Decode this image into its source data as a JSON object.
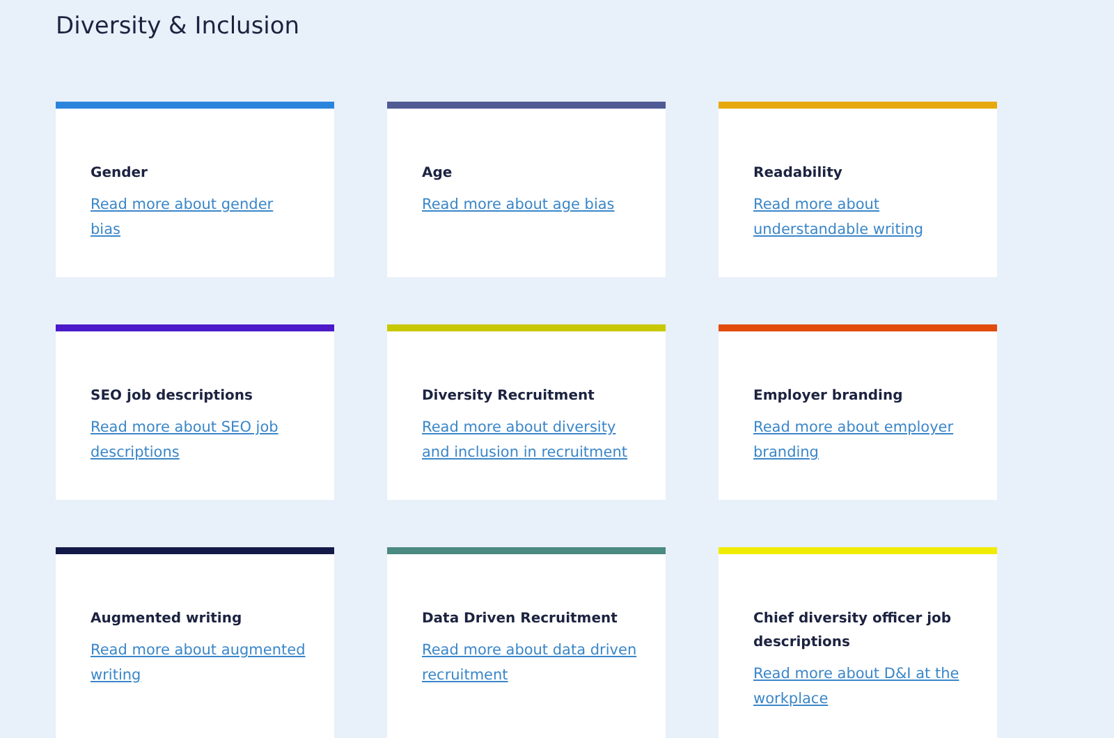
{
  "page": {
    "title": "Diversity & Inclusion"
  },
  "cards": [
    {
      "title": "Gender",
      "link": "Read more about gender bias",
      "color": "#2b84dc"
    },
    {
      "title": "Age",
      "link": "Read more about age bias",
      "color": "#4f5b94"
    },
    {
      "title": "Readability",
      "link": "Read more about understandable writing",
      "color": "#e6a80a"
    },
    {
      "title": "SEO job descriptions",
      "link": "Read more about SEO job descriptions",
      "color": "#4b19c8"
    },
    {
      "title": "Diversity Recruitment",
      "link": "Read more about diversity and inclusion in recruitment",
      "color": "#c8c800"
    },
    {
      "title": "Employer branding",
      "link": "Read more about employer branding",
      "color": "#e04c0a"
    },
    {
      "title": "Augmented writing",
      "link": "Read more about augmented writing",
      "color": "#141a48"
    },
    {
      "title": "Data Driven Recruitment",
      "link": "Read more about data driven recruitment",
      "color": "#4a8a80"
    },
    {
      "title": "Chief diversity officer job descriptions",
      "link": "Read more about D&I at the workplace",
      "color": "#f0ec00"
    }
  ]
}
